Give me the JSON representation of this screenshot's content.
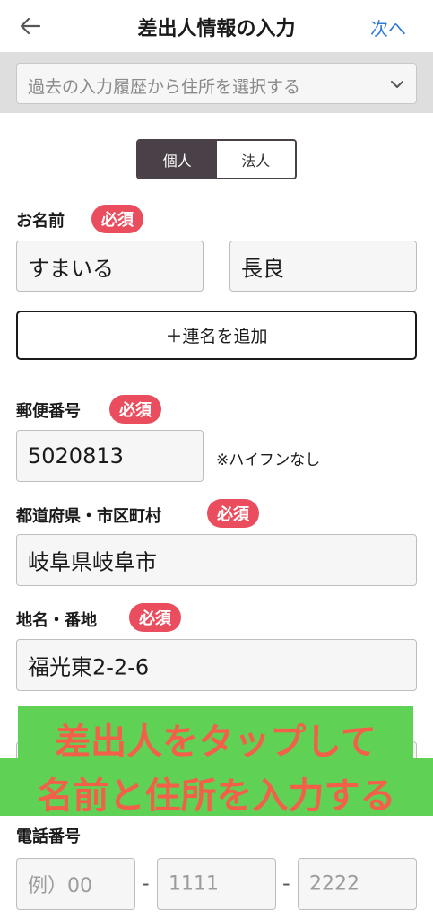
{
  "header": {
    "title": "差出人情報の入力",
    "next_label": "次へ"
  },
  "history": {
    "placeholder": "過去の入力履歴から住所を選択する"
  },
  "type_toggle": {
    "individual": "個人",
    "corporate": "法人"
  },
  "name": {
    "label": "お名前",
    "required": "必須",
    "last_name": "すまいる",
    "first_name": "長良",
    "add_joint": "＋連名を追加"
  },
  "postal": {
    "label": "郵便番号",
    "required": "必須",
    "value": "5020813",
    "hint": "※ハイフンなし"
  },
  "pref_city": {
    "label": "都道府県・市区町村",
    "required": "必須",
    "value": "岐阜県岐阜市"
  },
  "street": {
    "label": "地名・番地",
    "required": "必須",
    "value": "福光東2-2-6"
  },
  "phone": {
    "label": "電話番号",
    "part1_placeholder": "例）00",
    "part2_placeholder": "1111",
    "part3_placeholder": "2222",
    "separator": "-"
  },
  "overlay": {
    "line1": "差出人をタップして",
    "line2": "名前と住所を入力する"
  }
}
